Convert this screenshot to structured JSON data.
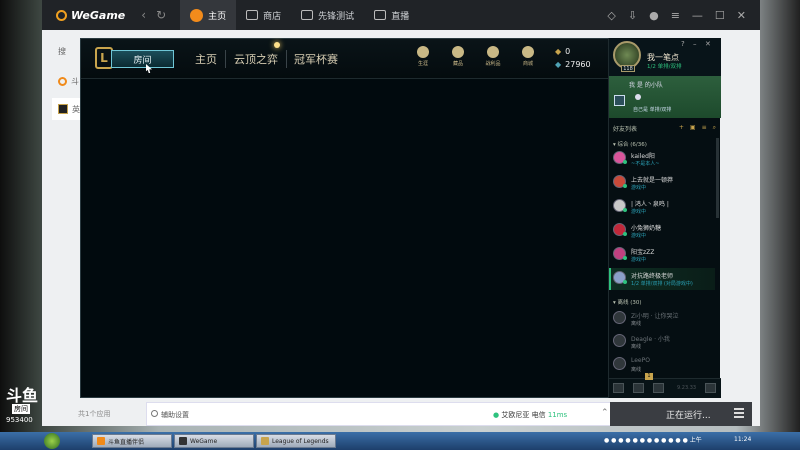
{
  "wegame": {
    "logo": "WeGame",
    "tabs": [
      {
        "label": "主页",
        "active": true
      },
      {
        "label": "商店"
      },
      {
        "label": "先锋测试"
      },
      {
        "label": "直播"
      }
    ],
    "sidebar": {
      "search_placeholder": "搜",
      "items": [
        "斗",
        "英"
      ]
    },
    "bottom": {
      "app_count": "共1个应用",
      "aux_label": "辅助设置",
      "game_status": "艾欧尼亚 电信",
      "ping": "11ms",
      "running": "正在运行..."
    }
  },
  "client": {
    "play_button": "房间",
    "nav": [
      "主页",
      "云顶之弈",
      "冠军杯赛"
    ],
    "nav_icons": [
      "生涯",
      "藏品",
      "战利品",
      "商城"
    ],
    "currency": {
      "rp": "0",
      "be": "27960"
    }
  },
  "social": {
    "profile": {
      "name": "我一笔点",
      "status": "1/2 单排/双排",
      "level": "118"
    },
    "party": {
      "title": "我 是 的小队",
      "status": "自己是 单排/双排"
    },
    "friend_list_title": "好友列表",
    "groups": [
      {
        "label": "综合 (6/36)"
      },
      {
        "label": "离线 (30)"
      }
    ],
    "friends_online": [
      {
        "name": "kailed阳",
        "status": "~不是本人~",
        "color": "#d9559b"
      },
      {
        "name": "上去就是一顿莽",
        "status": "游戏中",
        "color": "#c94a3a"
      },
      {
        "name": "| 鸿人丶泉鸣 |",
        "status": "游戏中",
        "color": "#c8c8c8"
      },
      {
        "name": "小兔狮奶糖",
        "status": "游戏中",
        "color": "#c0283a"
      },
      {
        "name": "阳宝zZZ",
        "status": "游戏中",
        "color": "#c04080"
      },
      {
        "name": "对抗路终极老师",
        "status": "1/2 单排/双排 (对局游戏中)",
        "color": "#8aa0c8"
      }
    ],
    "friends_offline": [
      {
        "name": "Zi小明 · 让你哭泣",
        "status": "离线"
      },
      {
        "name": "Deagle · 小我",
        "status": "离线"
      },
      {
        "name": "LeePO",
        "status": "离线"
      }
    ],
    "version": "9.23.33",
    "badge": "1"
  },
  "watermark": {
    "brand": "斗鱼",
    "room": "房间",
    "id": "953400"
  },
  "taskbar": {
    "items": [
      "斗鱼直播伴侣",
      "WeGame",
      "League of Legends"
    ],
    "tray": "上午",
    "time": "11:24"
  }
}
